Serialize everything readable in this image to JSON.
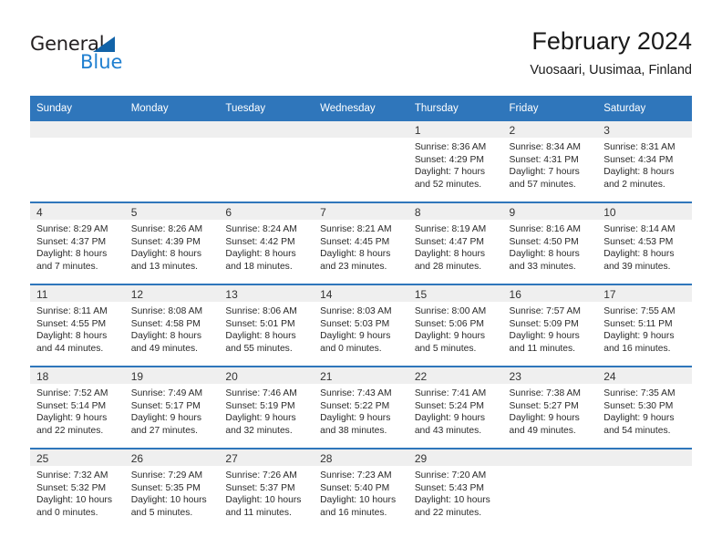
{
  "branding": {
    "logo_text_primary": "General",
    "logo_text_secondary": "Blue",
    "accent_color": "#1f7fd0",
    "triangle_color": "#1263a8",
    "triangle_icon": "triangle-icon"
  },
  "header": {
    "title": "February 2024",
    "subtitle": "Vuosaari, Uusimaa, Finland"
  },
  "calendar": {
    "header_bg": "#2f76bb",
    "daynum_band_bg": "#efefef",
    "weekdays": [
      "Sunday",
      "Monday",
      "Tuesday",
      "Wednesday",
      "Thursday",
      "Friday",
      "Saturday"
    ],
    "weeks": [
      [
        {
          "day": "",
          "lines": []
        },
        {
          "day": "",
          "lines": []
        },
        {
          "day": "",
          "lines": []
        },
        {
          "day": "",
          "lines": []
        },
        {
          "day": "1",
          "lines": [
            "Sunrise: 8:36 AM",
            "Sunset: 4:29 PM",
            "Daylight: 7 hours",
            "and 52 minutes."
          ]
        },
        {
          "day": "2",
          "lines": [
            "Sunrise: 8:34 AM",
            "Sunset: 4:31 PM",
            "Daylight: 7 hours",
            "and 57 minutes."
          ]
        },
        {
          "day": "3",
          "lines": [
            "Sunrise: 8:31 AM",
            "Sunset: 4:34 PM",
            "Daylight: 8 hours",
            "and 2 minutes."
          ]
        }
      ],
      [
        {
          "day": "4",
          "lines": [
            "Sunrise: 8:29 AM",
            "Sunset: 4:37 PM",
            "Daylight: 8 hours",
            "and 7 minutes."
          ]
        },
        {
          "day": "5",
          "lines": [
            "Sunrise: 8:26 AM",
            "Sunset: 4:39 PM",
            "Daylight: 8 hours",
            "and 13 minutes."
          ]
        },
        {
          "day": "6",
          "lines": [
            "Sunrise: 8:24 AM",
            "Sunset: 4:42 PM",
            "Daylight: 8 hours",
            "and 18 minutes."
          ]
        },
        {
          "day": "7",
          "lines": [
            "Sunrise: 8:21 AM",
            "Sunset: 4:45 PM",
            "Daylight: 8 hours",
            "and 23 minutes."
          ]
        },
        {
          "day": "8",
          "lines": [
            "Sunrise: 8:19 AM",
            "Sunset: 4:47 PM",
            "Daylight: 8 hours",
            "and 28 minutes."
          ]
        },
        {
          "day": "9",
          "lines": [
            "Sunrise: 8:16 AM",
            "Sunset: 4:50 PM",
            "Daylight: 8 hours",
            "and 33 minutes."
          ]
        },
        {
          "day": "10",
          "lines": [
            "Sunrise: 8:14 AM",
            "Sunset: 4:53 PM",
            "Daylight: 8 hours",
            "and 39 minutes."
          ]
        }
      ],
      [
        {
          "day": "11",
          "lines": [
            "Sunrise: 8:11 AM",
            "Sunset: 4:55 PM",
            "Daylight: 8 hours",
            "and 44 minutes."
          ]
        },
        {
          "day": "12",
          "lines": [
            "Sunrise: 8:08 AM",
            "Sunset: 4:58 PM",
            "Daylight: 8 hours",
            "and 49 minutes."
          ]
        },
        {
          "day": "13",
          "lines": [
            "Sunrise: 8:06 AM",
            "Sunset: 5:01 PM",
            "Daylight: 8 hours",
            "and 55 minutes."
          ]
        },
        {
          "day": "14",
          "lines": [
            "Sunrise: 8:03 AM",
            "Sunset: 5:03 PM",
            "Daylight: 9 hours",
            "and 0 minutes."
          ]
        },
        {
          "day": "15",
          "lines": [
            "Sunrise: 8:00 AM",
            "Sunset: 5:06 PM",
            "Daylight: 9 hours",
            "and 5 minutes."
          ]
        },
        {
          "day": "16",
          "lines": [
            "Sunrise: 7:57 AM",
            "Sunset: 5:09 PM",
            "Daylight: 9 hours",
            "and 11 minutes."
          ]
        },
        {
          "day": "17",
          "lines": [
            "Sunrise: 7:55 AM",
            "Sunset: 5:11 PM",
            "Daylight: 9 hours",
            "and 16 minutes."
          ]
        }
      ],
      [
        {
          "day": "18",
          "lines": [
            "Sunrise: 7:52 AM",
            "Sunset: 5:14 PM",
            "Daylight: 9 hours",
            "and 22 minutes."
          ]
        },
        {
          "day": "19",
          "lines": [
            "Sunrise: 7:49 AM",
            "Sunset: 5:17 PM",
            "Daylight: 9 hours",
            "and 27 minutes."
          ]
        },
        {
          "day": "20",
          "lines": [
            "Sunrise: 7:46 AM",
            "Sunset: 5:19 PM",
            "Daylight: 9 hours",
            "and 32 minutes."
          ]
        },
        {
          "day": "21",
          "lines": [
            "Sunrise: 7:43 AM",
            "Sunset: 5:22 PM",
            "Daylight: 9 hours",
            "and 38 minutes."
          ]
        },
        {
          "day": "22",
          "lines": [
            "Sunrise: 7:41 AM",
            "Sunset: 5:24 PM",
            "Daylight: 9 hours",
            "and 43 minutes."
          ]
        },
        {
          "day": "23",
          "lines": [
            "Sunrise: 7:38 AM",
            "Sunset: 5:27 PM",
            "Daylight: 9 hours",
            "and 49 minutes."
          ]
        },
        {
          "day": "24",
          "lines": [
            "Sunrise: 7:35 AM",
            "Sunset: 5:30 PM",
            "Daylight: 9 hours",
            "and 54 minutes."
          ]
        }
      ],
      [
        {
          "day": "25",
          "lines": [
            "Sunrise: 7:32 AM",
            "Sunset: 5:32 PM",
            "Daylight: 10 hours",
            "and 0 minutes."
          ]
        },
        {
          "day": "26",
          "lines": [
            "Sunrise: 7:29 AM",
            "Sunset: 5:35 PM",
            "Daylight: 10 hours",
            "and 5 minutes."
          ]
        },
        {
          "day": "27",
          "lines": [
            "Sunrise: 7:26 AM",
            "Sunset: 5:37 PM",
            "Daylight: 10 hours",
            "and 11 minutes."
          ]
        },
        {
          "day": "28",
          "lines": [
            "Sunrise: 7:23 AM",
            "Sunset: 5:40 PM",
            "Daylight: 10 hours",
            "and 16 minutes."
          ]
        },
        {
          "day": "29",
          "lines": [
            "Sunrise: 7:20 AM",
            "Sunset: 5:43 PM",
            "Daylight: 10 hours",
            "and 22 minutes."
          ]
        },
        {
          "day": "",
          "lines": []
        },
        {
          "day": "",
          "lines": []
        }
      ]
    ]
  }
}
